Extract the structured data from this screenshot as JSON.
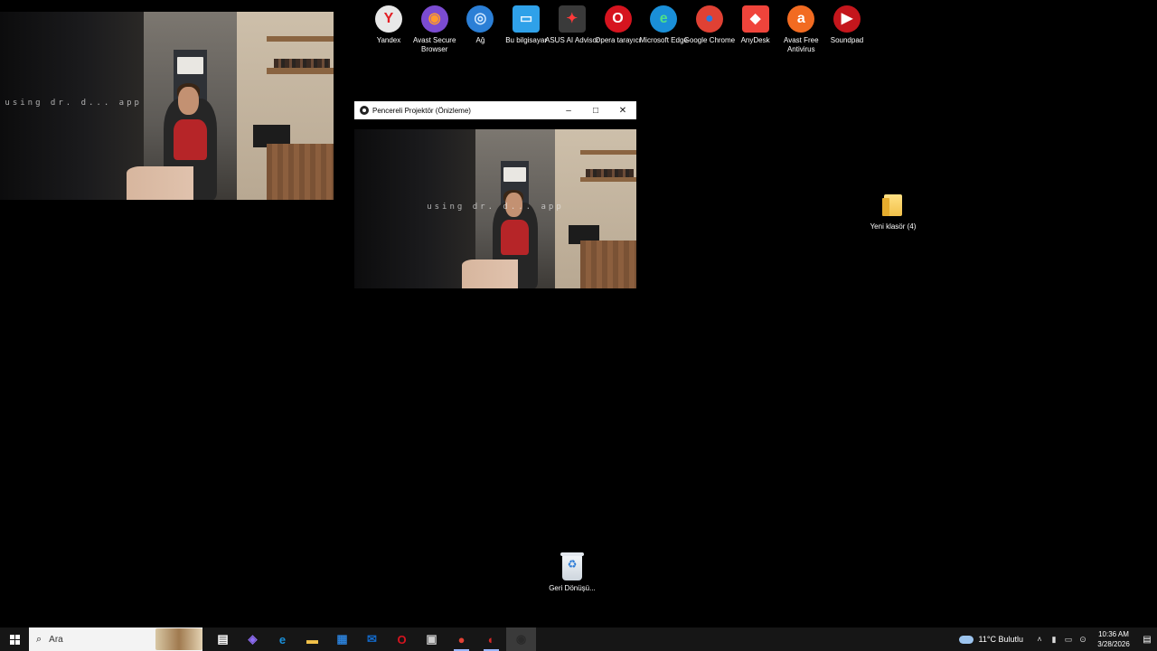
{
  "camera_watermark": "using dr. d... app",
  "desktop_icons": [
    {
      "id": "yandex",
      "label": "Yandex",
      "glyph": "Y",
      "color": "#e8e8e8",
      "fg": "#e31e24"
    },
    {
      "id": "avast-secure-browser",
      "label": "Avast Secure Browser",
      "glyph": "◉",
      "color": "#7b4bd1",
      "fg": "#ff9a2e"
    },
    {
      "id": "network",
      "label": "Ağ",
      "glyph": "◎",
      "color": "#2b7fd6",
      "fg": "#cde6ff"
    },
    {
      "id": "this-pc",
      "label": "Bu bilgisayar",
      "glyph": "▭",
      "color": "#2fa1e9",
      "fg": "#e8f4ff"
    },
    {
      "id": "asus-ai-advisor",
      "label": "ASUS AI Advisor",
      "glyph": "✦",
      "color": "#3a3a3a",
      "fg": "#ff3a3a"
    },
    {
      "id": "opera",
      "label": "Opera tarayıcı",
      "glyph": "O",
      "color": "#d6141f",
      "fg": "#ffffff"
    },
    {
      "id": "microsoft-edge",
      "label": "Microsoft Edge",
      "glyph": "e",
      "color": "#1a8fd8",
      "fg": "#4fe08a"
    },
    {
      "id": "google-chrome",
      "label": "Google Chrome",
      "glyph": "●",
      "color": "#e04134",
      "fg": "#2a7ae2"
    },
    {
      "id": "anydesk",
      "label": "AnyDesk",
      "glyph": "◆",
      "color": "#ef443b",
      "fg": "#ffffff"
    },
    {
      "id": "avast-free-antivirus",
      "label": "Avast Free Antivirus",
      "glyph": "a",
      "color": "#f26b21",
      "fg": "#ffffff"
    },
    {
      "id": "soundpad",
      "label": "Soundpad",
      "glyph": "▶",
      "color": "#c4161c",
      "fg": "#ffffff"
    }
  ],
  "folder": {
    "label": "Yeni klasör (4)"
  },
  "recycle_bin": {
    "label": "Geri Dönüşü..."
  },
  "projector_window": {
    "title": "Pencereli Projektör (Önizleme)",
    "minimize": "–",
    "maximize": "□",
    "close": "✕"
  },
  "taskbar": {
    "search_placeholder": "Ara",
    "search_glyph": "⌕",
    "apps": [
      {
        "name": "task-view",
        "glyph": "▤",
        "color": "#ffffff",
        "state": ""
      },
      {
        "name": "copilot",
        "glyph": "◈",
        "color": "#8f6df5",
        "state": ""
      },
      {
        "name": "edge",
        "glyph": "e",
        "color": "#1a8fd8",
        "state": ""
      },
      {
        "name": "file-explorer",
        "glyph": "▬",
        "color": "#f2c14a",
        "state": ""
      },
      {
        "name": "microsoft-store",
        "glyph": "▦",
        "color": "#2b7fd6",
        "state": ""
      },
      {
        "name": "outlook",
        "glyph": "✉",
        "color": "#1369c8",
        "state": ""
      },
      {
        "name": "opera",
        "glyph": "O",
        "color": "#d6141f",
        "state": ""
      },
      {
        "name": "app-window",
        "glyph": "▣",
        "color": "#cfcfcf",
        "state": ""
      },
      {
        "name": "chrome",
        "glyph": "●",
        "color": "#e04134",
        "state": "running"
      },
      {
        "name": "obs-alt",
        "glyph": "◐",
        "color": "#d62828",
        "state": "running"
      },
      {
        "name": "obs-studio",
        "glyph": "◉",
        "color": "#2a2a2a",
        "state": "active"
      }
    ],
    "weather": "11°C  Bulutlu",
    "tray_icons": [
      "˄",
      "▮",
      "▭",
      "⊙"
    ],
    "time": "10:36 AM",
    "date": "3/28/2026",
    "notifications": "▤"
  }
}
